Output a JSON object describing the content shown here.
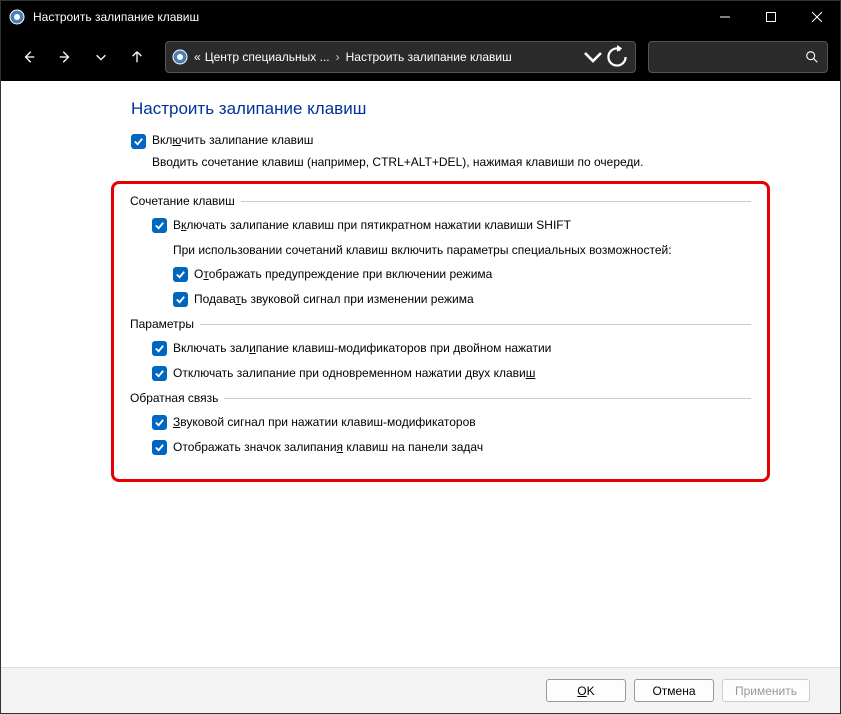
{
  "window_title": "Настроить залипание клавиш",
  "breadcrumb": {
    "a": "Центр специальных ...",
    "b": "Настроить залипание клавиш"
  },
  "page": {
    "title": "Настроить залипание клавиш",
    "enable_pre": "Вкл",
    "enable_u": "ю",
    "enable_post": "чить залипание клавиш",
    "desc": "Вводить сочетание клавиш (например, CTRL+ALT+DEL), нажимая клавиши по очереди."
  },
  "g1": {
    "legend": "Сочетание клавиш",
    "o1_pre": "В",
    "o1_u": "к",
    "o1_post": "лючать залипание клавиш при пятикратном нажатии клавиши SHIFT",
    "sub": "При использовании сочетаний клавиш включить параметры специальных возможностей:",
    "o2_pre": "О",
    "o2_u": "т",
    "o2_post": "ображать предупреждение при включении режима",
    "o3_pre": "Подава",
    "o3_u": "т",
    "o3_post": "ь звуковой сигнал при изменении режима"
  },
  "g2": {
    "legend": "Параметры",
    "o1_pre": "Включать зал",
    "o1_u": "и",
    "o1_post": "пание клавиш-модификаторов при двойном нажатии",
    "o2_pre": "Отключать залипание при одновременном нажатии двух клави",
    "o2_u": "ш",
    "o2_post": ""
  },
  "g3": {
    "legend": "Обратная связь",
    "o1_u": "З",
    "o1_post": "вуковой сигнал при нажатии клавиш-модификаторов",
    "o2_pre": "Отображать значок залипани",
    "o2_u": "я",
    "o2_post": " клавиш на панели задач"
  },
  "footer": {
    "ok_u": "O",
    "ok_post": "K",
    "cancel": "Отмена",
    "apply": "Применить"
  }
}
